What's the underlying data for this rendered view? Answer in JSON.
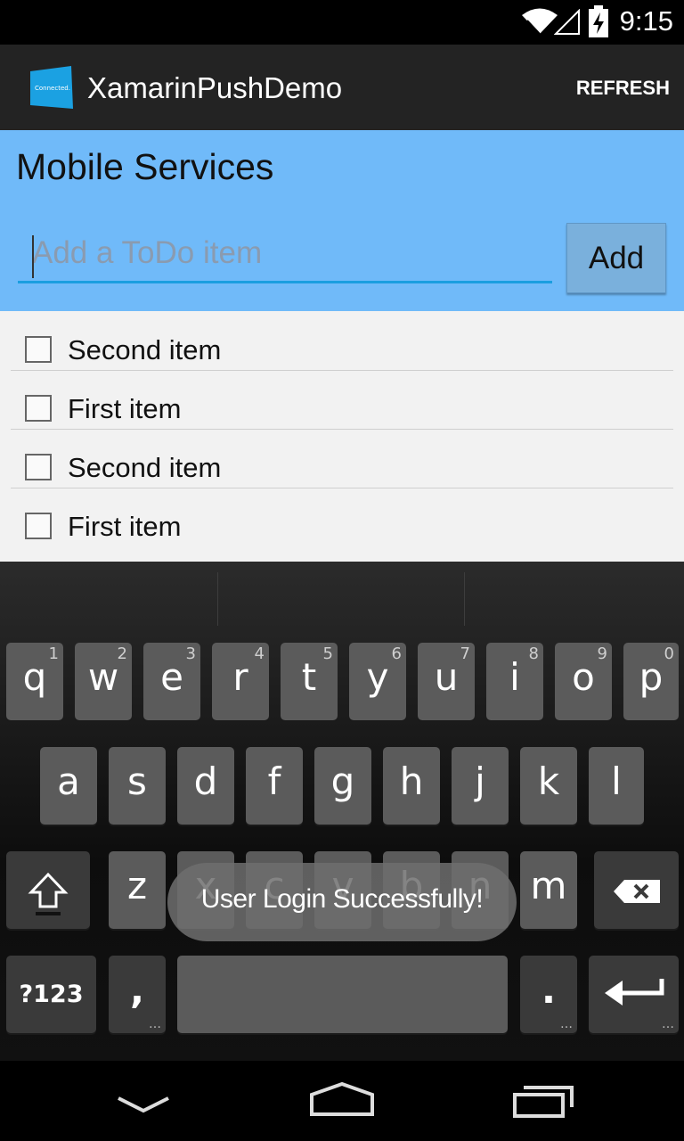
{
  "status_bar": {
    "time": "9:15"
  },
  "action_bar": {
    "title": "XamarinPushDemo",
    "refresh_label": "REFRESH",
    "icon_text": "Connected."
  },
  "header": {
    "title": "Mobile Services",
    "input_placeholder": "Add a ToDo item",
    "add_label": "Add"
  },
  "todo_items": [
    {
      "label": "Second item",
      "checked": false
    },
    {
      "label": "First item",
      "checked": false
    },
    {
      "label": "Second item",
      "checked": false
    },
    {
      "label": "First item",
      "checked": false
    }
  ],
  "keyboard": {
    "row1": [
      {
        "k": "q",
        "n": "1"
      },
      {
        "k": "w",
        "n": "2"
      },
      {
        "k": "e",
        "n": "3"
      },
      {
        "k": "r",
        "n": "4"
      },
      {
        "k": "t",
        "n": "5"
      },
      {
        "k": "y",
        "n": "6"
      },
      {
        "k": "u",
        "n": "7"
      },
      {
        "k": "i",
        "n": "8"
      },
      {
        "k": "o",
        "n": "9"
      },
      {
        "k": "p",
        "n": "0"
      }
    ],
    "row2": [
      "a",
      "s",
      "d",
      "f",
      "g",
      "h",
      "j",
      "k",
      "l"
    ],
    "row3": [
      "z",
      "x",
      "c",
      "v",
      "b",
      "n",
      "m"
    ],
    "symbols_label": "?123",
    "comma_label": ",",
    "period_label": "."
  },
  "toast": {
    "text": "User Login Successfully!"
  },
  "colors": {
    "accent": "#1a9ee0",
    "header_bg": "#70baf9",
    "action_bar_bg": "#232323"
  }
}
